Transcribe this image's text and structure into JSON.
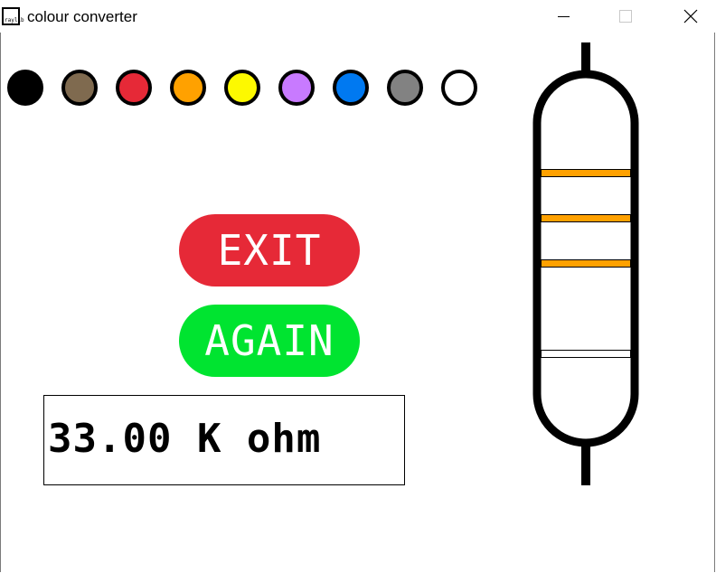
{
  "window": {
    "title": "colour converter",
    "icon_label": "raylib",
    "controls": [
      "minimize-icon",
      "maximize-icon",
      "close-icon"
    ]
  },
  "palette": {
    "colors": [
      {
        "name": "black",
        "hex": "#000000"
      },
      {
        "name": "brown",
        "hex": "#7f6a4f"
      },
      {
        "name": "red",
        "hex": "#e62937"
      },
      {
        "name": "orange",
        "hex": "#ffa100"
      },
      {
        "name": "yellow",
        "hex": "#fdf900"
      },
      {
        "name": "violet",
        "hex": "#c87aff"
      },
      {
        "name": "blue",
        "hex": "#0079f1"
      },
      {
        "name": "grey",
        "hex": "#828282"
      },
      {
        "name": "white",
        "hex": "#ffffff"
      }
    ]
  },
  "buttons": {
    "exit_label": "EXIT",
    "exit_color": "#e62937",
    "again_label": "AGAIN",
    "again_color": "#00e430"
  },
  "result": {
    "text": "33.00 K ohm"
  },
  "resistor": {
    "bands": [
      {
        "name": "orange",
        "hex": "#ffa100"
      },
      {
        "name": "orange",
        "hex": "#ffa100"
      },
      {
        "name": "orange",
        "hex": "#ffa100"
      },
      {
        "name": "white",
        "hex": "#ffffff"
      }
    ]
  }
}
